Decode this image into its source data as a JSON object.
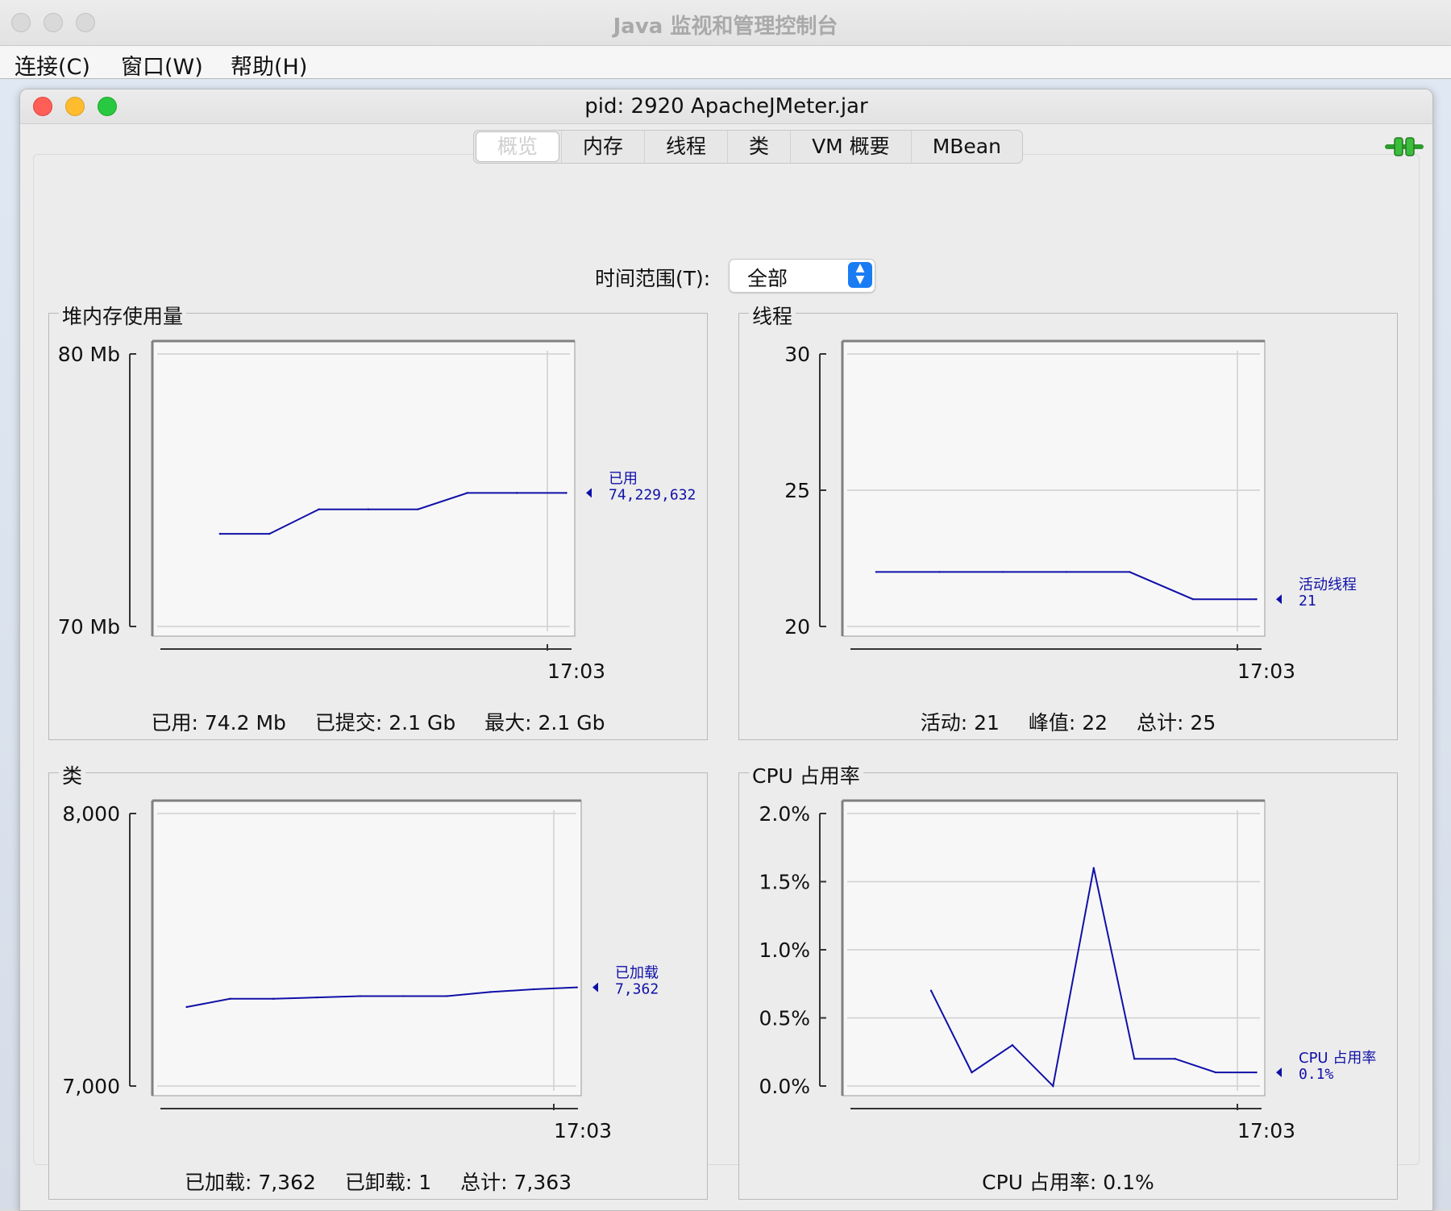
{
  "app": {
    "window_title": "Java 监视和管理控制台",
    "menu": [
      "连接(C)",
      "窗口(W)",
      "帮助(H)"
    ]
  },
  "inner_window": {
    "title": "pid: 2920 ApacheJMeter.jar",
    "tabs": [
      "概览",
      "内存",
      "线程",
      "类",
      "VM 概要",
      "MBean"
    ],
    "active_tab": "概览"
  },
  "time_range": {
    "label": "时间范围(T):",
    "value": "全部"
  },
  "colors": {
    "series": "#1010a8",
    "grid": "#cfcfcf",
    "plot_bg": "#f7f7f7"
  },
  "panels": {
    "heap": {
      "title": "堆内存使用量",
      "stats": [
        "已用: 74.2 Mb",
        "已提交: 2.1 Gb",
        "最大: 2.1 Gb"
      ],
      "legend_name": "已用",
      "legend_value": "74,229,632",
      "y_top_label": "80 Mb",
      "y_bottom_label": "70 Mb",
      "x_label": "17:03"
    },
    "threads": {
      "title": "线程",
      "stats": [
        "活动: 21",
        "峰值: 22",
        "总计: 25"
      ],
      "legend_name": "活动线程",
      "legend_value": "21",
      "x_label": "17:03"
    },
    "classes": {
      "title": "类",
      "stats": [
        "已加载: 7,362",
        "已卸载: 1",
        "总计: 7,363"
      ],
      "legend_name": "已加载",
      "legend_value": "7,362",
      "x_label": "17:03"
    },
    "cpu": {
      "title": "CPU 占用率",
      "stats": [
        "CPU 占用率: 0.1%"
      ],
      "legend_name": "CPU 占用率",
      "legend_value": "0.1%",
      "x_label": "17:03"
    }
  },
  "chart_data": [
    {
      "type": "line",
      "title": "堆内存使用量",
      "ylim": [
        70,
        80
      ],
      "y_unit": "Mb",
      "y_ticks": [
        70,
        80
      ],
      "x_tick_labels": [
        "17:03"
      ],
      "x": [
        0,
        1,
        2,
        3,
        4,
        5,
        6,
        7
      ],
      "series": [
        {
          "name": "已用",
          "values": [
            73.4,
            73.4,
            74.3,
            74.3,
            74.3,
            74.9,
            74.9,
            74.9
          ]
        }
      ]
    },
    {
      "type": "line",
      "title": "线程",
      "ylim": [
        20,
        30
      ],
      "y_ticks": [
        20,
        25,
        30
      ],
      "x_tick_labels": [
        "17:03"
      ],
      "x": [
        0,
        1,
        2,
        3,
        4,
        5,
        6
      ],
      "series": [
        {
          "name": "活动线程",
          "values": [
            22,
            22,
            22,
            22,
            22,
            21,
            21
          ]
        }
      ]
    },
    {
      "type": "line",
      "title": "类",
      "ylim": [
        7000,
        8000
      ],
      "y_ticks": [
        7000,
        8000
      ],
      "x_tick_labels": [
        "17:03"
      ],
      "x": [
        0,
        1,
        2,
        3,
        4,
        5,
        6,
        7,
        8,
        9
      ],
      "series": [
        {
          "name": "已加载",
          "values": [
            7290,
            7320,
            7320,
            7325,
            7330,
            7330,
            7330,
            7345,
            7355,
            7362
          ]
        }
      ]
    },
    {
      "type": "line",
      "title": "CPU 占用率",
      "ylim": [
        0,
        2.0
      ],
      "y_unit": "%",
      "y_ticks": [
        0.0,
        0.5,
        1.0,
        1.5,
        2.0
      ],
      "x_tick_labels": [
        "17:03"
      ],
      "x": [
        0,
        1,
        2,
        3,
        4,
        5,
        6,
        7,
        8
      ],
      "series": [
        {
          "name": "CPU 占用率",
          "values": [
            0.7,
            0.1,
            0.3,
            0.0,
            1.6,
            0.2,
            0.2,
            0.1,
            0.1
          ]
        }
      ]
    }
  ]
}
